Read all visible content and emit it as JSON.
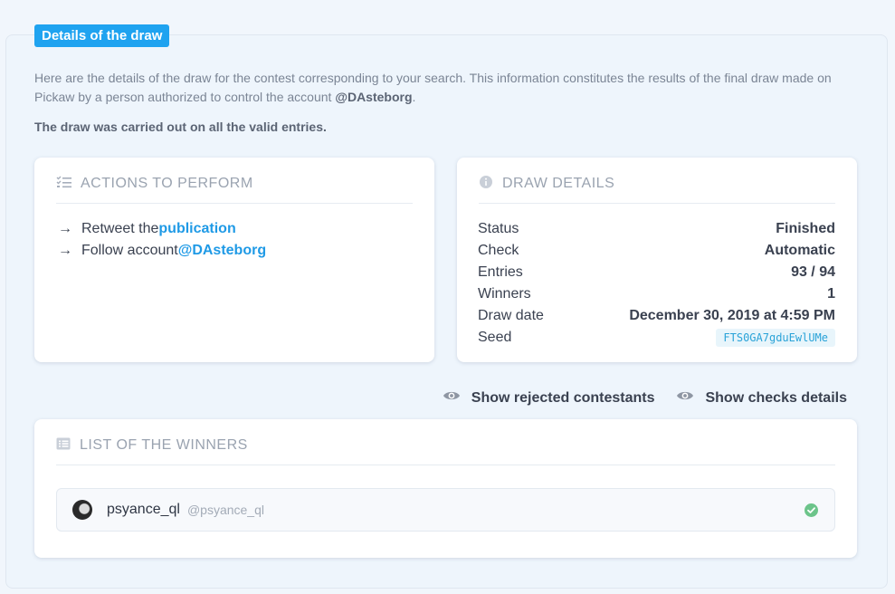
{
  "section": {
    "title": "Details of the draw",
    "intro_text": "Here are the details of the draw for the contest corresponding to your search. This information constitutes the results of the final draw made on Pickaw by a person authorized to control the account ",
    "intro_account": "@DAsteborg",
    "intro_end": ".",
    "note": "The draw was carried out on all the valid entries."
  },
  "actions": {
    "title": "ACTIONS TO PERFORM",
    "items": [
      {
        "prefix": "Retweet the ",
        "link": "publication"
      },
      {
        "prefix": "Follow account ",
        "link": "@DAsteborg"
      }
    ]
  },
  "details": {
    "title": "DRAW DETAILS",
    "rows": [
      {
        "label": "Status",
        "value": "Finished"
      },
      {
        "label": "Check",
        "value": "Automatic"
      },
      {
        "label": "Entries",
        "value": "93 / 94"
      },
      {
        "label": "Winners",
        "value": "1"
      },
      {
        "label": "Draw date",
        "value": "December 30, 2019 at 4:59 PM"
      },
      {
        "label": "Seed",
        "value": "FTS0GA7gduEwlUMe"
      }
    ]
  },
  "toggles": {
    "rejected": "Show rejected contestants",
    "checks": "Show checks details"
  },
  "winners": {
    "title": "LIST OF THE WINNERS",
    "items": [
      {
        "name": "psyance_ql",
        "handle": "@psyance_ql",
        "status_icon": "check-circle-icon"
      }
    ]
  },
  "colors": {
    "accent": "#1fa3f0",
    "link": "#1f9ae6",
    "success": "#6cc48a"
  }
}
